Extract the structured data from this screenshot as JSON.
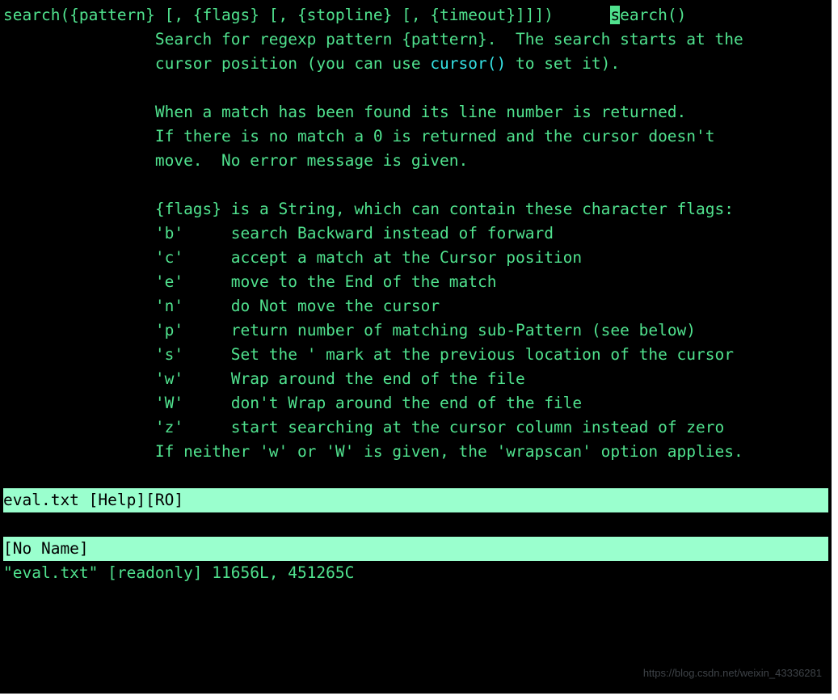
{
  "help": {
    "signature_pre": "search({pattern} [, {flags} [, {stopline} [, {timeout}]]])",
    "tag_mark": "s",
    "tag_rest": "earch()",
    "intro_line1_a": "Search for regexp pattern {pattern}.  The search starts at the",
    "intro_line2_a": "cursor position (you can use ",
    "intro_line2_cursor": "cursor()",
    "intro_line2_b": " to set it).",
    "match_line1": "When a match has been found its line number is returned.",
    "match_line2": "If there is no match a 0 is returned and the cursor doesn't",
    "match_line3": "move.  No error message is given.",
    "flags_hdr": "{flags} is a String, which can contain these character flags:",
    "flags": [
      {
        "k": "'b'",
        "d": "search Backward instead of forward"
      },
      {
        "k": "'c'",
        "d": "accept a match at the Cursor position"
      },
      {
        "k": "'e'",
        "d": "move to the End of the match"
      },
      {
        "k": "'n'",
        "d": "do Not move the cursor"
      },
      {
        "k": "'p'",
        "d": "return number of matching sub-Pattern (see below)"
      },
      {
        "k": "'s'",
        "d": "Set the ' mark at the previous location of the cursor"
      },
      {
        "k": "'w'",
        "d": "Wrap around the end of the file"
      },
      {
        "k": "'W'",
        "d": "don't Wrap around the end of the file"
      },
      {
        "k": "'z'",
        "d": "start searching at the cursor column instead of zero"
      }
    ],
    "flags_footer": "If neither 'w' or 'W' is given, the 'wrapscan' option applies."
  },
  "status": {
    "top_statusline": "eval.txt [Help][RO]",
    "bottom_statusline": "[No Name]",
    "cmdline": "\"eval.txt\" [readonly] 11656L, 451265C"
  },
  "file": {
    "lines": 11656,
    "chars": 451265
  },
  "watermark": "https://blog.csdn.net/weixin_43336281"
}
